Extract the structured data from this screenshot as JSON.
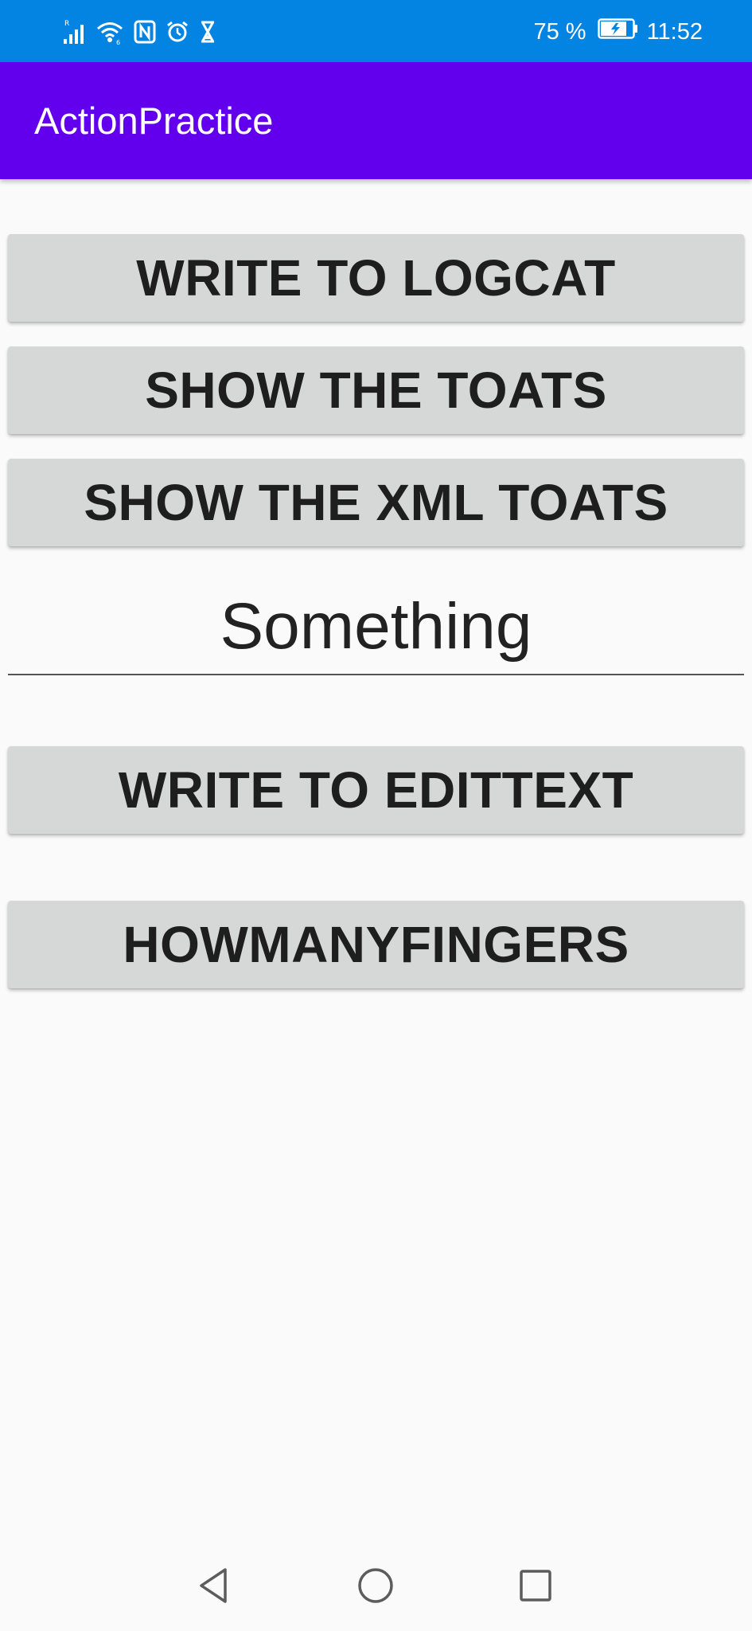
{
  "status_bar": {
    "battery_percent": "75 %",
    "time": "11:52",
    "icons": [
      "signal-icon",
      "wifi-icon",
      "nfc-icon",
      "alarm-icon",
      "hourglass-icon",
      "battery-charging-icon"
    ],
    "background": "#0384e2"
  },
  "app_bar": {
    "title": "ActionPractice",
    "background": "#6200ee"
  },
  "main": {
    "write_logcat_label": "WRITE TO LOGCAT",
    "show_toast_label": "SHOW THE TOATS",
    "show_xml_toast_label": "SHOW THE XML TOATS",
    "edit_text_value": "Something",
    "write_edittext_label": "WRITE TO EDITTEXT",
    "how_many_fingers_label": "HOWMANYFINGERS",
    "button_background": "#d6d7d7"
  },
  "nav_bar": {
    "icons": [
      "back-icon",
      "home-icon",
      "recents-icon"
    ]
  }
}
